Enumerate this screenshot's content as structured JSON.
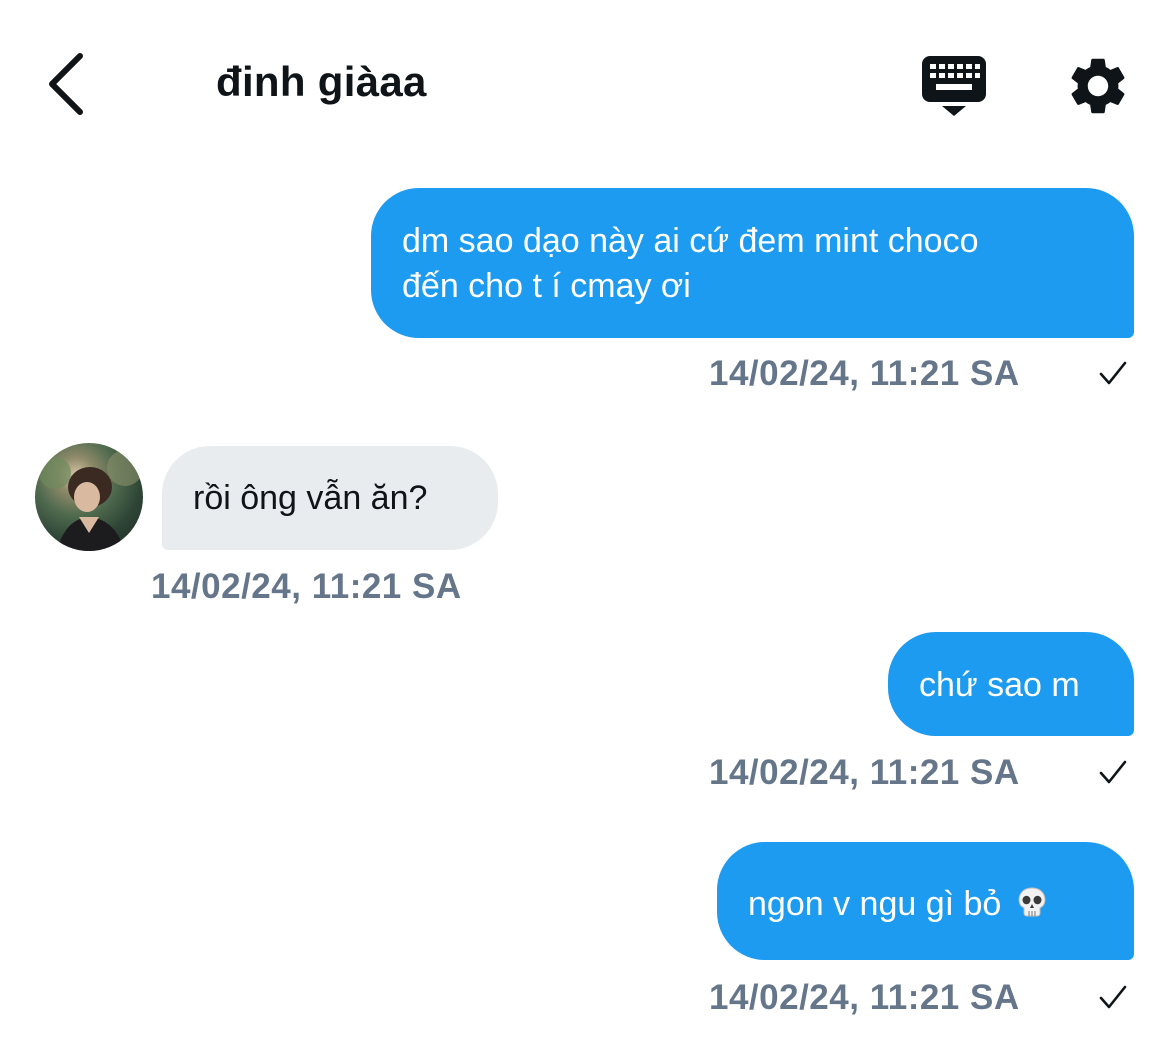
{
  "header": {
    "title": "đinh giàaa",
    "back_icon": "chevron-left-icon",
    "keyboard_icon": "keyboard-hide-icon",
    "settings_icon": "gear-icon"
  },
  "messages": [
    {
      "direction": "outgoing",
      "lines": [
        "dm sao dạo này ai cứ đem mint choco",
        "đến cho t í cmay ơi"
      ],
      "timestamp": "14/02/24, 11:21 SA",
      "status_icon": "checkmark-icon"
    },
    {
      "direction": "incoming",
      "text": "rồi ông vẫn ăn?",
      "timestamp": "14/02/24, 11:21 SA",
      "avatar_icon": "avatar"
    },
    {
      "direction": "outgoing",
      "text": "chứ sao m",
      "timestamp": "14/02/24, 11:21 SA",
      "status_icon": "checkmark-icon"
    },
    {
      "direction": "outgoing",
      "text": "ngon v ngu gì bỏ",
      "emoji_icon": "skull-emoji-icon",
      "timestamp": "14/02/24, 11:21 SA",
      "status_icon": "checkmark-icon"
    }
  ],
  "colors": {
    "outgoing_bubble": "#1d9bf0",
    "incoming_bubble": "#e8ecef",
    "timestamp": "#66768a",
    "text": "#0f1419"
  }
}
